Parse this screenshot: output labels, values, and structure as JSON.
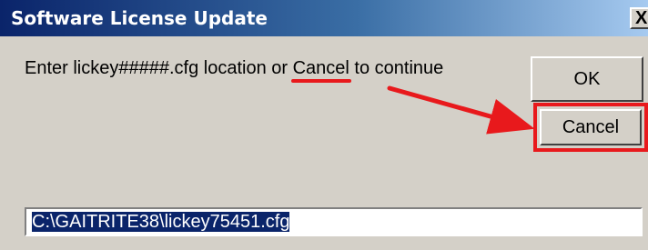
{
  "window": {
    "title": "Software License Update",
    "close_glyph": "X"
  },
  "message": {
    "before": "Enter lickey#####.cfg location or ",
    "keyword": "Cancel",
    "after": " to continue"
  },
  "buttons": {
    "ok_label": "OK",
    "cancel_label": "Cancel"
  },
  "path_field": {
    "value": "C:\\GAITRITE38\\lickey75451.cfg"
  },
  "colors": {
    "titlebar_start": "#0a246a",
    "titlebar_end": "#a6caf0",
    "dialog_bg": "#d4d0c8",
    "annotation_red": "#e8191c",
    "selection_bg": "#0a246a"
  },
  "annotations": {
    "icon": "arrow-right-icon"
  }
}
